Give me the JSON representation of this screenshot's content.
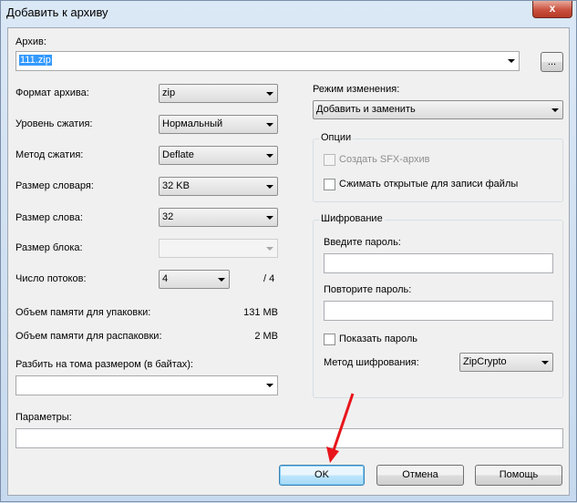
{
  "window": {
    "title": "Добавить к архиву",
    "close_glyph": "x"
  },
  "archive": {
    "label": "Архив:",
    "value": "111.zip",
    "browse_label": "..."
  },
  "left": {
    "format_label": "Формат архива:",
    "format_value": "zip",
    "level_label": "Уровень сжатия:",
    "level_value": "Нормальный",
    "method_label": "Метод сжатия:",
    "method_value": "Deflate",
    "dict_label": "Размер словаря:",
    "dict_value": "32 KB",
    "word_label": "Размер слова:",
    "word_value": "32",
    "block_label": "Размер блока:",
    "block_value": "",
    "threads_label": "Число потоков:",
    "threads_value": "4",
    "threads_max": "/ 4",
    "mem_pack_label": "Объем памяти для упаковки:",
    "mem_pack_value": "131 MB",
    "mem_unpack_label": "Объем памяти для распаковки:",
    "mem_unpack_value": "2 MB",
    "split_label": "Разбить на тома размером (в байтах):",
    "split_value": "",
    "params_label": "Параметры:",
    "params_value": ""
  },
  "right": {
    "mode_label": "Режим изменения:",
    "mode_value": "Добавить и заменить",
    "options_title": "Опции",
    "sfx_label": "Создать SFX-архив",
    "compress_open_label": "Сжимать открытые для записи файлы",
    "enc_title": "Шифрование",
    "password_label": "Введите пароль:",
    "repeat_label": "Повторите пароль:",
    "show_password_label": "Показать пароль",
    "enc_method_label": "Метод шифрования:",
    "enc_method_value": "ZipCrypto"
  },
  "buttons": {
    "ok": "OK",
    "cancel": "Отмена",
    "help": "Помощь"
  },
  "annotation": {
    "arrow_color": "#e8141b"
  }
}
